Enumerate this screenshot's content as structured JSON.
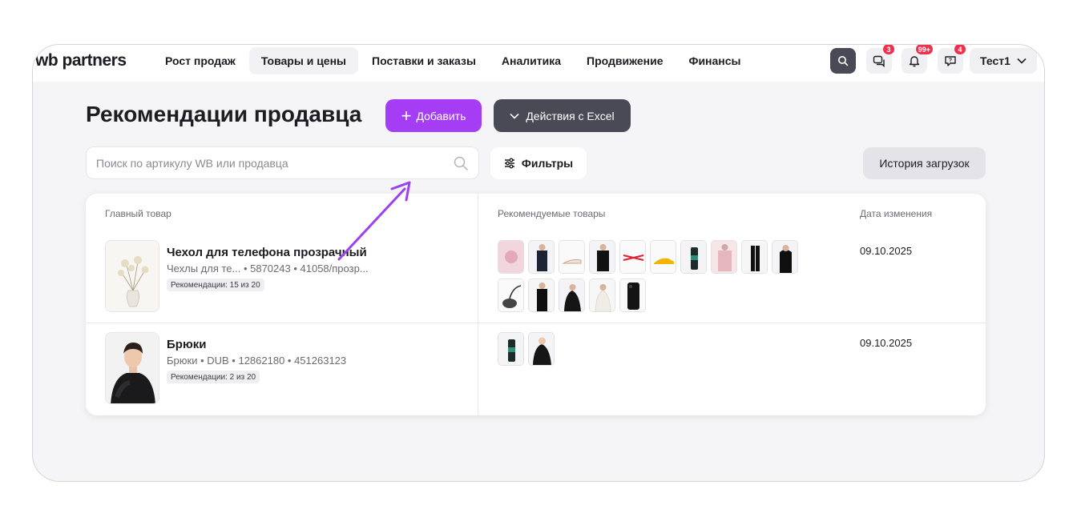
{
  "logo": {
    "text": "wb partners"
  },
  "nav": [
    {
      "label": "Рост продаж",
      "active": false
    },
    {
      "label": "Товары и цены",
      "active": true
    },
    {
      "label": "Поставки и заказы",
      "active": false
    },
    {
      "label": "Аналитика",
      "active": false
    },
    {
      "label": "Продвижение",
      "active": false
    },
    {
      "label": "Финансы",
      "active": false
    }
  ],
  "header_icons": {
    "chat_badge": "3",
    "notifications_badge": "99+",
    "support_badge": "4"
  },
  "user": {
    "name": "Тест1"
  },
  "page": {
    "title": "Рекомендации продавца",
    "add_label": "Добавить",
    "excel_label": "Действия с Excel",
    "search_placeholder": "Поиск по артикулу WB или продавца",
    "filters_label": "Фильтры",
    "history_label": "История загрузок"
  },
  "table": {
    "headers": {
      "main": "Главный товар",
      "recommended": "Рекомендуемые товары",
      "date": "Дата изменения"
    },
    "rows": [
      {
        "name": "Чехол для телефона прозрачный",
        "meta": "Чехлы для те... • 5870243 • 41058/прозр...",
        "badge": "Рекомендации: 15 из 20",
        "date": "09.10.2025",
        "rec_count": 15
      },
      {
        "name": "Брюки",
        "meta": "Брюки • DUB • 12862180 • 451263123",
        "badge": "Рекомендации: 2 из 20",
        "date": "09.10.2025",
        "rec_count": 2
      }
    ]
  },
  "colors": {
    "accent": "#a53df4",
    "dark_button": "#4a4a56",
    "badge": "#f2304e",
    "arrow": "#9b42f0"
  }
}
